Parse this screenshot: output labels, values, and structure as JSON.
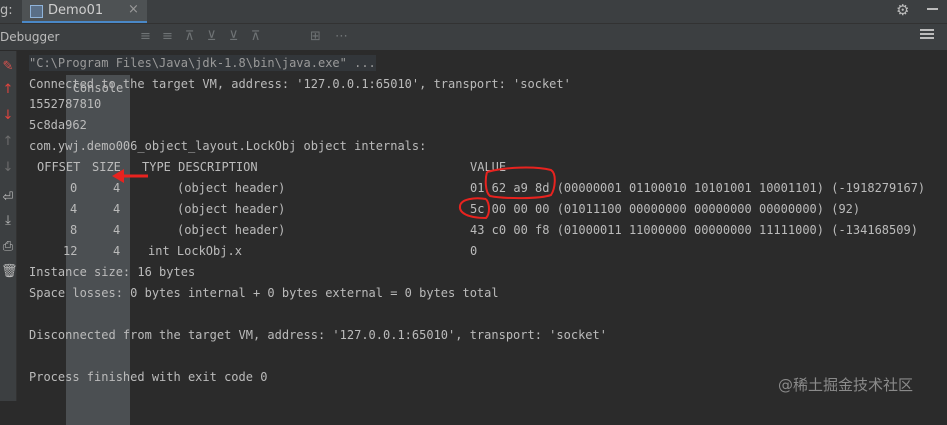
{
  "titlebar": {
    "debug_label": "g:",
    "run_tab": "Demo01",
    "close": "×"
  },
  "toolbar": {
    "debugger": "Debugger",
    "console": "Console",
    "icons": [
      "≡",
      "≡",
      "⊼",
      "⊻",
      "⊻",
      "⊼",
      "⊞",
      "⋯"
    ]
  },
  "sidebar_icons": [
    "stop-icon",
    "step-up-icon",
    "step-down-icon",
    "step-out-icon",
    "step-into-icon",
    "wrap-icon",
    "scroll-end-icon",
    "print-icon",
    "trash-icon"
  ],
  "console": {
    "command": "\"C:\\Program Files\\Java\\jdk-1.8\\bin\\java.exe\" ...",
    "connected": "Connected to the target VM, address: '127.0.0.1:65010', transport: 'socket'",
    "hash_decimal": "1552787810",
    "hash_hex": "5c8da962",
    "object_title": "com.ywj.demo006_object_layout.LockObj object internals:",
    "table": {
      "headers": {
        "offset": "OFFSET",
        "size": "SIZE",
        "type": "TYPE DESCRIPTION",
        "value": "VALUE"
      },
      "rows": [
        {
          "offset": "0",
          "size": "4",
          "desc": "(object header)",
          "value": "01 62 a9 8d (00000001 01100010 10101001 10001101) (-1918279167)"
        },
        {
          "offset": "4",
          "size": "4",
          "desc": "(object header)",
          "value": "5c 00 00 00 (01011100 00000000 00000000 00000000) (92)"
        },
        {
          "offset": "8",
          "size": "4",
          "desc": "(object header)",
          "value": "43 c0 00 f8 (01000011 11000000 00000000 11111000) (-134168509)"
        },
        {
          "offset": "12",
          "size": "4",
          "desc": "int LockObj.x",
          "value": "0"
        }
      ]
    },
    "instance_size": "Instance size: 16 bytes",
    "space_losses": "Space losses: 0 bytes internal + 0 bytes external = 0 bytes total",
    "disconnected": "Disconnected from the target VM, address: '127.0.0.1:65010', transport: 'socket'",
    "exit": "Process finished with exit code 0"
  },
  "watermark": "@稀土掘金技术社区",
  "colors": {
    "annotation_red": "#e8231f",
    "console_bg": "#2b2b2b",
    "panel_bg": "#3c3f41",
    "text": "#bbbbbb"
  }
}
